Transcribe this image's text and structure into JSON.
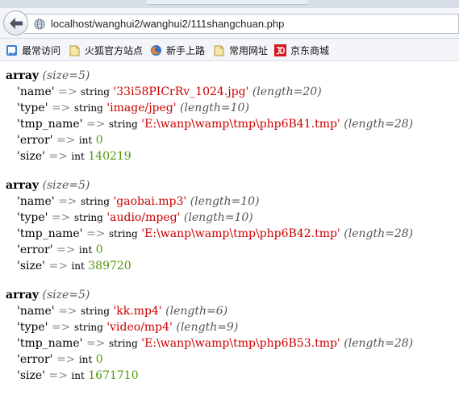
{
  "browser": {
    "url": "localhost/wanghui2/wanghui2/111shangchuan.php"
  },
  "bookmarks": [
    {
      "label": "最常访问",
      "icon": "most-visited-icon"
    },
    {
      "label": "火狐官方站点",
      "icon": "folder-icon"
    },
    {
      "label": "新手上路",
      "icon": "firefox-icon"
    },
    {
      "label": "常用网址",
      "icon": "folder-icon"
    },
    {
      "label": "京东商城",
      "icon": "jd-icon"
    }
  ],
  "dumps": [
    {
      "keyword": "array",
      "size": "(size=5)",
      "rows": [
        {
          "key": "'name'",
          "arrow": "=>",
          "type": "string",
          "value": "'33i58PICrRv_1024.jpg'",
          "vclass": "str",
          "len": "(length=20)"
        },
        {
          "key": "'type'",
          "arrow": "=>",
          "type": "string",
          "value": "'image/jpeg'",
          "vclass": "str",
          "len": "(length=10)"
        },
        {
          "key": "'tmp_name'",
          "arrow": "=>",
          "type": "string",
          "value": "'E:\\wanp\\wamp\\tmp\\php6B41.tmp'",
          "vclass": "str",
          "len": "(length=28)"
        },
        {
          "key": "'error'",
          "arrow": "=>",
          "type": "int",
          "value": "0",
          "vclass": "num",
          "len": ""
        },
        {
          "key": "'size'",
          "arrow": "=>",
          "type": "int",
          "value": "140219",
          "vclass": "num",
          "len": ""
        }
      ]
    },
    {
      "keyword": "array",
      "size": "(size=5)",
      "rows": [
        {
          "key": "'name'",
          "arrow": "=>",
          "type": "string",
          "value": "'gaobai.mp3'",
          "vclass": "str",
          "len": "(length=10)"
        },
        {
          "key": "'type'",
          "arrow": "=>",
          "type": "string",
          "value": "'audio/mpeg'",
          "vclass": "str",
          "len": "(length=10)"
        },
        {
          "key": "'tmp_name'",
          "arrow": "=>",
          "type": "string",
          "value": "'E:\\wanp\\wamp\\tmp\\php6B42.tmp'",
          "vclass": "str",
          "len": "(length=28)"
        },
        {
          "key": "'error'",
          "arrow": "=>",
          "type": "int",
          "value": "0",
          "vclass": "num",
          "len": ""
        },
        {
          "key": "'size'",
          "arrow": "=>",
          "type": "int",
          "value": "389720",
          "vclass": "num",
          "len": ""
        }
      ]
    },
    {
      "keyword": "array",
      "size": "(size=5)",
      "rows": [
        {
          "key": "'name'",
          "arrow": "=>",
          "type": "string",
          "value": "'kk.mp4'",
          "vclass": "str",
          "len": "(length=6)"
        },
        {
          "key": "'type'",
          "arrow": "=>",
          "type": "string",
          "value": "'video/mp4'",
          "vclass": "str",
          "len": "(length=9)"
        },
        {
          "key": "'tmp_name'",
          "arrow": "=>",
          "type": "string",
          "value": "'E:\\wanp\\wamp\\tmp\\php6B53.tmp'",
          "vclass": "str",
          "len": "(length=28)"
        },
        {
          "key": "'error'",
          "arrow": "=>",
          "type": "int",
          "value": "0",
          "vclass": "num",
          "len": ""
        },
        {
          "key": "'size'",
          "arrow": "=>",
          "type": "int",
          "value": "1671710",
          "vclass": "num",
          "len": ""
        }
      ]
    }
  ],
  "colors": {
    "string_value": "#cc0000",
    "int_value": "#4e9a06",
    "arrow": "#888a85",
    "meta": "#555555"
  }
}
